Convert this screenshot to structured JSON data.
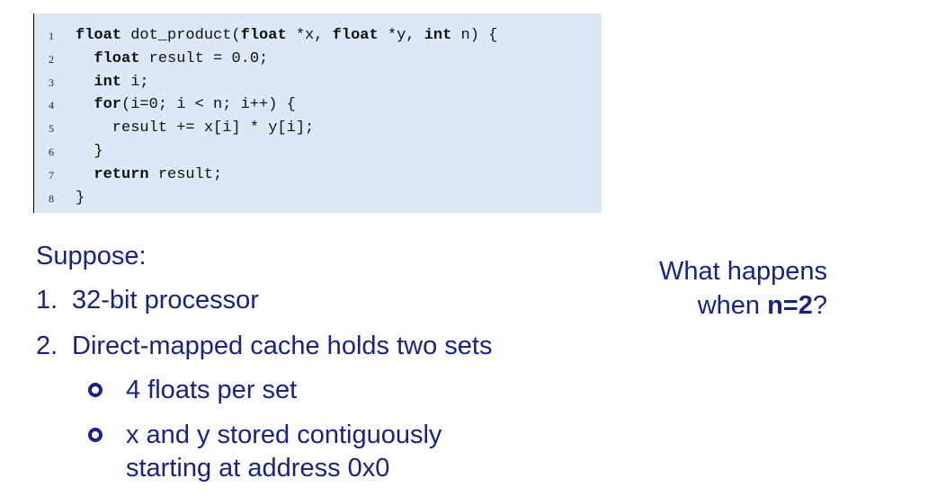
{
  "code": {
    "lines": [
      {
        "num": "1",
        "parts": [
          {
            "t": "float",
            "kw": true
          },
          {
            "t": " dot_product(",
            "kw": false
          },
          {
            "t": "float",
            "kw": true
          },
          {
            "t": " *x, ",
            "kw": false
          },
          {
            "t": "float",
            "kw": true
          },
          {
            "t": " *y, ",
            "kw": false
          },
          {
            "t": "int",
            "kw": true
          },
          {
            "t": " n) {",
            "kw": false
          }
        ]
      },
      {
        "num": "2",
        "parts": [
          {
            "t": "  ",
            "kw": false
          },
          {
            "t": "float",
            "kw": true
          },
          {
            "t": " result = 0.0;",
            "kw": false
          }
        ]
      },
      {
        "num": "3",
        "parts": [
          {
            "t": "  ",
            "kw": false
          },
          {
            "t": "int",
            "kw": true
          },
          {
            "t": " i;",
            "kw": false
          }
        ]
      },
      {
        "num": "4",
        "parts": [
          {
            "t": "  ",
            "kw": false
          },
          {
            "t": "for",
            "kw": true
          },
          {
            "t": "(i=0; i < n; i++) {",
            "kw": false
          }
        ]
      },
      {
        "num": "5",
        "parts": [
          {
            "t": "    result += x[i] * y[i];",
            "kw": false
          }
        ]
      },
      {
        "num": "6",
        "parts": [
          {
            "t": "  }",
            "kw": false
          }
        ]
      },
      {
        "num": "7",
        "parts": [
          {
            "t": "  ",
            "kw": false
          },
          {
            "t": "return",
            "kw": true
          },
          {
            "t": " result;",
            "kw": false
          }
        ]
      },
      {
        "num": "8",
        "parts": [
          {
            "t": "}",
            "kw": false
          }
        ]
      }
    ]
  },
  "slide": {
    "suppose": "Suppose:",
    "item1_num": "1.",
    "item1": "32-bit processor",
    "item2_num": "2.",
    "item2": "Direct-mapped cache holds two sets",
    "sub1": "4 floats per set",
    "sub2_line1": "x and y stored contiguously",
    "sub2_line2": "starting at address 0x0"
  },
  "note": {
    "line1": "What happens",
    "line2_prefix": "when ",
    "line2_bold": "n=2",
    "line2_suffix": "?"
  }
}
